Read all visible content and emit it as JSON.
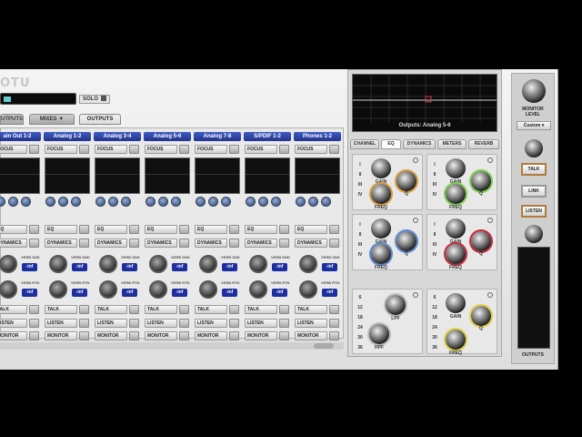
{
  "header": {
    "logo": "OTU",
    "solo_label": "SOLO"
  },
  "tabs": [
    {
      "label": "UTPUTS",
      "active": false
    },
    {
      "label": "MIXES",
      "active": false
    },
    {
      "label": "OUTPUTS",
      "active": true
    }
  ],
  "channels": [
    {
      "name": "ain Out 1-2"
    },
    {
      "name": "Analog 1-2"
    },
    {
      "name": "Analog 3-4"
    },
    {
      "name": "Analog 5-6"
    },
    {
      "name": "Analog 7-8"
    },
    {
      "name": "S/PDIF 1-2"
    },
    {
      "name": "Phones 1-2"
    }
  ],
  "strip_buttons": {
    "focus": "FOCUS",
    "eq": "EQ",
    "dynamics": "DYNAMICS",
    "talk": "TALK",
    "listen": "LISTEN",
    "monitor": "MONITOR",
    "verb_send": "VERB SND",
    "verb_return": "VERB RTN",
    "inf": "-inf"
  },
  "right_panel": {
    "display_title": "Outputs: Analog 5-6",
    "tabs": [
      "CHANNEL",
      "EQ",
      "DYNAMICS",
      "METERS",
      "REVERB"
    ],
    "active_tab": "EQ",
    "knob_labels": {
      "gain": "GAIN",
      "freq": "FREQ",
      "q": "Q",
      "lpf": "LPF",
      "hpf": "HPF"
    },
    "band_rows": [
      "I",
      "II",
      "III",
      "IV"
    ],
    "filter_rows": [
      "6",
      "12",
      "18",
      "24",
      "30",
      "36"
    ]
  },
  "right_column": {
    "monitor_label_1": "MONITOR",
    "monitor_label_2": "LEVEL",
    "custom_label": "Custom",
    "talk": "TALK",
    "link": "LINK",
    "listen": "LISTEN",
    "outputs_label": "OUTPUTS"
  },
  "colors": {
    "channel_name_bg": "#2a3ea0",
    "accent_green": "#7bd04a",
    "accent_red": "#c8283a",
    "accent_orange": "#d89a3a",
    "accent_yellow": "#e0d040",
    "accent_blue": "#5a8ad0"
  }
}
